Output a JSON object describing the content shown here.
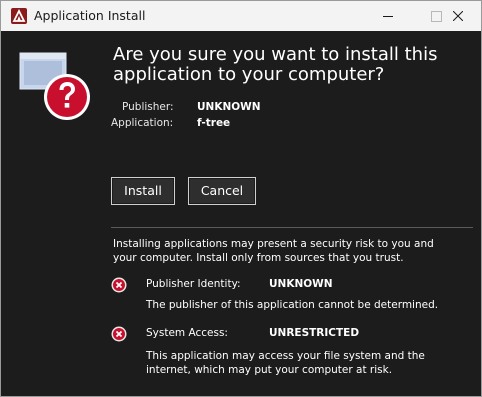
{
  "window": {
    "title": "Application Install"
  },
  "dialog": {
    "heading_line1": "Are you sure you want to install this",
    "heading_line2": "application to your computer?",
    "publisher_label": "Publisher:",
    "publisher_value": "UNKNOWN",
    "application_label": "Application:",
    "application_value": "f-tree",
    "install_button": "Install",
    "cancel_button": "Cancel",
    "warning_line1": "Installing applications may present a security risk to you and",
    "warning_line2": "your computer. Install only from sources that you trust.",
    "risks": [
      {
        "label": "Publisher Identity:",
        "value": "UNKNOWN",
        "desc_line1": "The publisher of this application cannot be determined.",
        "desc_line2": ""
      },
      {
        "label": "System Access:",
        "value": "UNRESTRICTED",
        "desc_line1": "This application may access your file system and the",
        "desc_line2": "internet, which may put your computer at risk."
      }
    ]
  },
  "colors": {
    "accent_red": "#c8102e",
    "background": "#1c1c1c",
    "titlebar": "#f3f3f3"
  },
  "icons": [
    "adobe-air-icon",
    "install-question-icon",
    "risk-x-icon"
  ]
}
